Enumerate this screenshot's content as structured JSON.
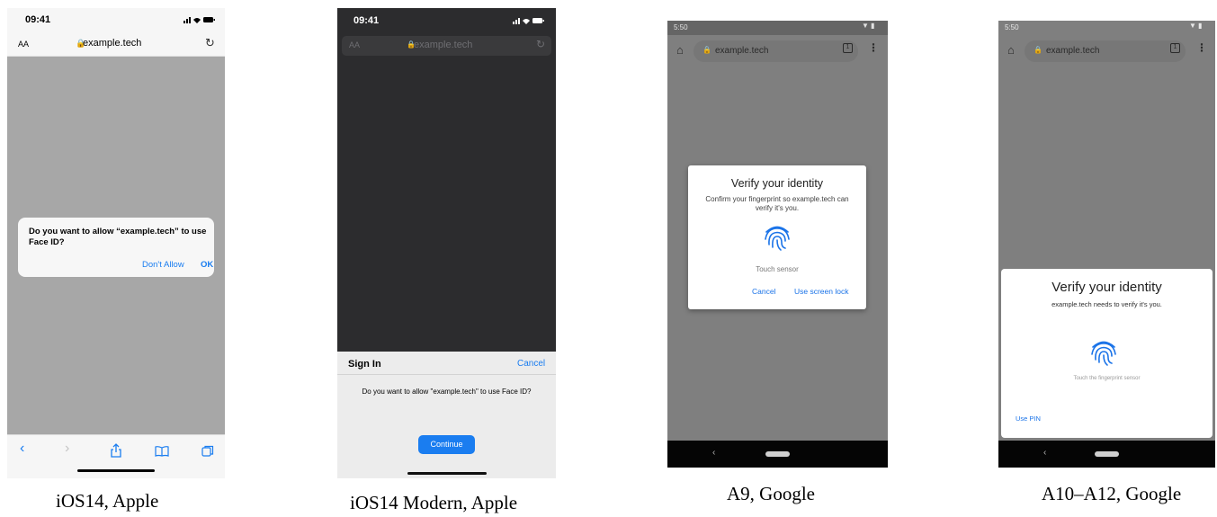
{
  "ios14": {
    "caption": "iOS14, Apple",
    "time": "09:41",
    "text_size_label": "AA",
    "host": "example.tech",
    "alert_text": "Do you want to allow “example.tech” to use Face ID?",
    "dont_allow": "Don't Allow",
    "ok": "OK"
  },
  "ios14_modern": {
    "caption": "iOS14 Modern, Apple",
    "time": "09:41",
    "text_size_label": "AA",
    "host": "example.tech",
    "sheet_title": "Sign In",
    "cancel": "Cancel",
    "message": "Do you want to allow \"example.tech\" to use Face ID?",
    "continue": "Continue"
  },
  "a9": {
    "caption": "A9, Google",
    "time": "5:50",
    "host": "example.tech",
    "tab_count": "1",
    "dialog_title": "Verify your identity",
    "dialog_subtitle": "Confirm your fingerprint so example.tech can verify it's you.",
    "touch_hint": "Touch sensor",
    "cancel": "Cancel",
    "use_screen_lock": "Use screen lock"
  },
  "a10_a12": {
    "caption": "A10–A12, Google",
    "time": "5:50",
    "host": "example.tech",
    "tab_count": "1",
    "sheet_title": "Verify your identity",
    "sheet_subtitle": "example.tech needs to verify it's you.",
    "touch_hint": "Touch the fingerprint sensor",
    "use_pin": "Use PIN"
  }
}
